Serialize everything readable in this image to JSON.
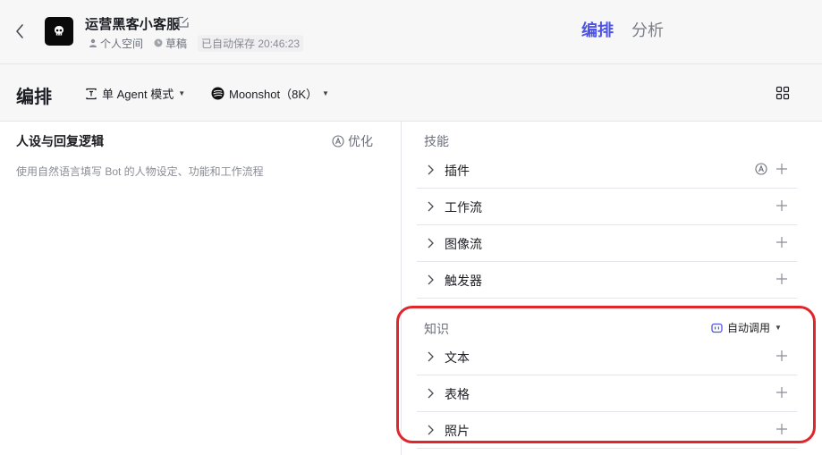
{
  "header": {
    "bot_name": "运营黑客小客服",
    "space": "个人空间",
    "status": "草稿",
    "autosave": "已自动保存 20:46:23",
    "tabs": [
      {
        "label": "编排",
        "active": true
      },
      {
        "label": "分析",
        "active": false
      }
    ],
    "accent_color": "#4d53e8"
  },
  "toolbar": {
    "title": "编排",
    "agent_mode": "单 Agent 模式",
    "model": "Moonshot（8K）"
  },
  "persona": {
    "title": "人设与回复逻辑",
    "optimize_label": "优化",
    "placeholder": "使用自然语言填写 Bot 的人物设定、功能和工作流程"
  },
  "skills": {
    "title": "技能",
    "items": [
      {
        "label": "插件"
      },
      {
        "label": "工作流"
      },
      {
        "label": "图像流"
      },
      {
        "label": "触发器"
      }
    ]
  },
  "knowledge": {
    "title": "知识",
    "auto_call_label": "自动调用",
    "items": [
      {
        "label": "文本"
      },
      {
        "label": "表格"
      },
      {
        "label": "照片"
      }
    ],
    "highlight_color": "#e0262b"
  }
}
